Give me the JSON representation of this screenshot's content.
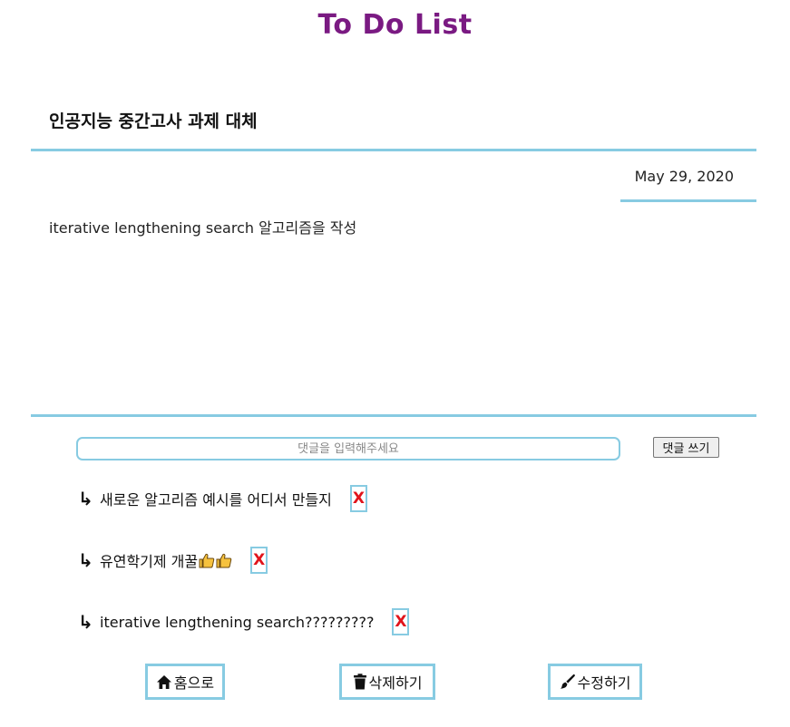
{
  "header": {
    "title": "To Do List"
  },
  "post": {
    "title": "인공지능 중간고사 과제 대체",
    "date": "May 29, 2020",
    "body": "iterative lengthening search 알고리즘을 작성"
  },
  "comment_form": {
    "placeholder": "댓글을 입력해주세요",
    "value": "",
    "submit_label": "댓글 쓰기"
  },
  "comments": [
    {
      "arrow": "↳",
      "text": "새로운 알고리즘 예시를 어디서 만들지",
      "delete_label": "X"
    },
    {
      "arrow": "↳",
      "text": "유연학기제 개꿀",
      "emoji": "thumbs-up-icon x2",
      "delete_label": "X"
    },
    {
      "arrow": "↳",
      "text": "iterative lengthening search?????????",
      "delete_label": "X"
    }
  ],
  "actions": {
    "home_label": "홈으로",
    "home_icon": "home-icon",
    "delete_label": "삭제하기",
    "delete_icon": "trash-icon",
    "edit_label": "수정하기",
    "edit_icon": "brush-icon"
  },
  "colors": {
    "title": "#7a1a82",
    "accent_border": "#87cbe2",
    "delete_x": "#e0141b",
    "thumbs": "#f6c23e"
  }
}
